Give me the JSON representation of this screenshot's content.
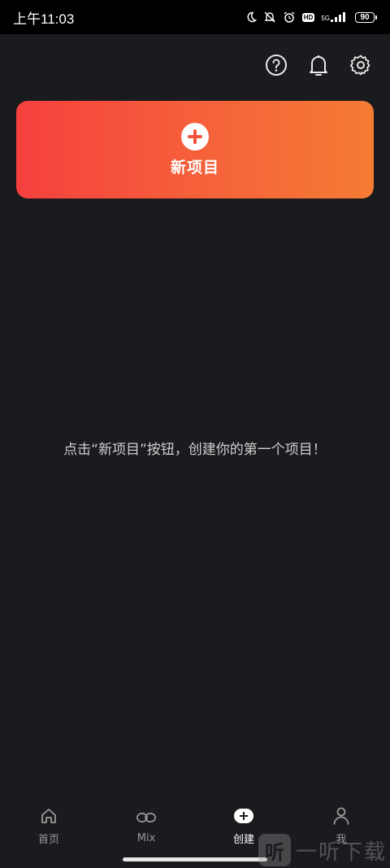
{
  "status_bar": {
    "time": "上午11:03",
    "network": "5G",
    "hd": "HD",
    "battery": "90",
    "icons": [
      "moon-icon",
      "mute-icon",
      "alarm-icon",
      "hd-icon",
      "signal-icon",
      "wifi-icon",
      "battery-icon"
    ]
  },
  "top_actions": {
    "icons": [
      "help-icon",
      "bell-icon",
      "gear-icon"
    ]
  },
  "new_project": {
    "label": "新项目",
    "colors": [
      "#f5403e",
      "#f57b34"
    ]
  },
  "empty_hint": {
    "text": "点击“新项目”按钮，创建你的第一个项目！"
  },
  "bottom_nav": {
    "items": [
      {
        "label": "首页",
        "icon": "home-icon",
        "active": false
      },
      {
        "label": "Mix",
        "icon": "infinity-icon",
        "active": false
      },
      {
        "label": "创建",
        "icon": "create-icon",
        "active": true
      },
      {
        "label": "我",
        "icon": "person-icon",
        "active": false
      }
    ]
  },
  "watermark": {
    "logo": "听",
    "text": "一听下载"
  }
}
